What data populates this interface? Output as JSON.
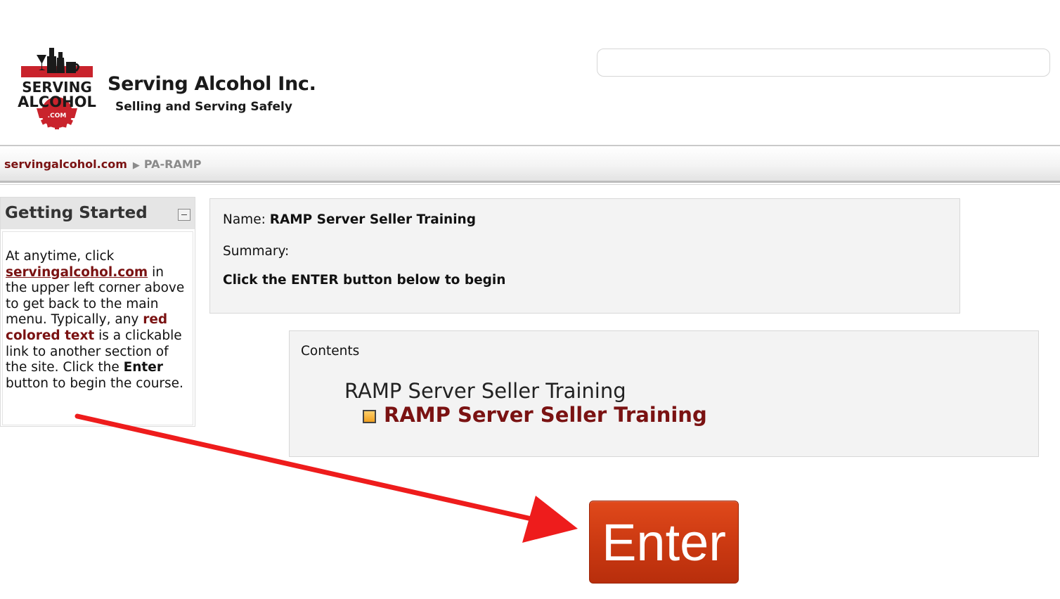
{
  "header": {
    "logo": {
      "line1": "SERVING",
      "line2": "ALCOHOL",
      "suffix": ".COM"
    },
    "brand_name": "Serving Alcohol Inc.",
    "tagline": "Selling and Serving Safely",
    "search": {
      "value": "",
      "placeholder": ""
    }
  },
  "breadcrumb": {
    "home": "servingalcohol.com",
    "separator": "▶",
    "current": "PA-RAMP"
  },
  "sidebar": {
    "title": "Getting Started",
    "collapse_symbol": "−",
    "text": {
      "p1": "At anytime, click ",
      "link1": "servingalcohol.com",
      "p2": " in the upper left corner above to get back to the main menu. Typically, any ",
      "link2": "red colored text",
      "p3": " is a clickable link to another section of the site.  Click the ",
      "bold1": "Enter",
      "p4": " button to begin the course."
    }
  },
  "info": {
    "name_label": "Name:",
    "name_value": "RAMP Server Seller Training",
    "summary_label": "Summary:",
    "instruction": "Click the ENTER button below to begin"
  },
  "contents": {
    "label": "Contents",
    "course_title": "RAMP Server Seller Training",
    "lesson_link": "RAMP Server Seller Training"
  },
  "enter_button": {
    "label": "Enter",
    "color": "#cc3a12"
  },
  "colors": {
    "link_red": "#7a1212",
    "arrow_red": "#ee1c1c",
    "panel_gray": "#f3f3f3"
  }
}
